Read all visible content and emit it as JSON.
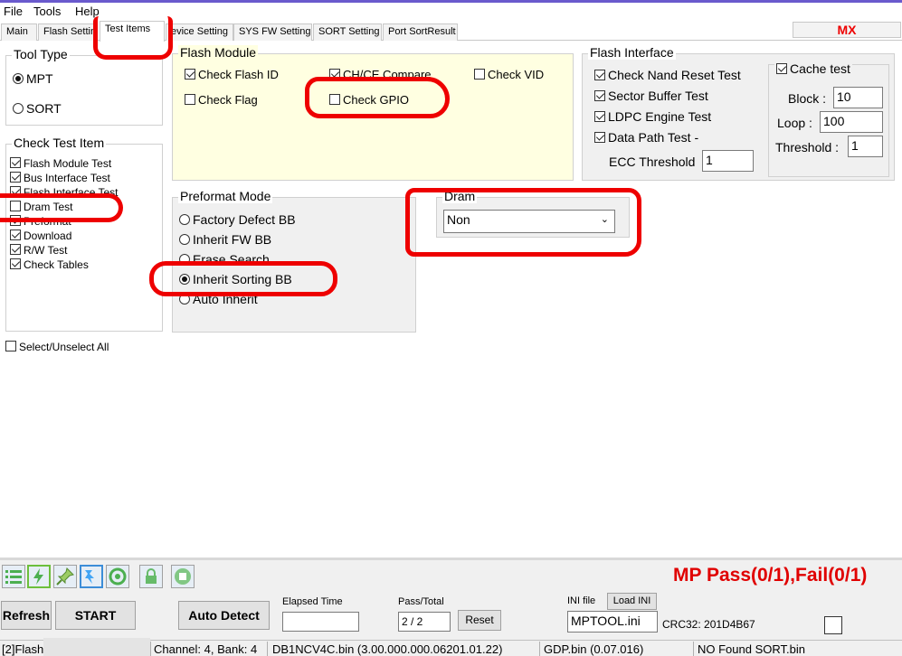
{
  "menu": {
    "file": "File",
    "tools": "Tools",
    "help": "Help"
  },
  "tabs": [
    "Main",
    "Flash Settin",
    "Test Items",
    "evice Setting",
    "SYS FW Setting",
    "SORT Setting",
    "Port SortResult"
  ],
  "mx_label": "MX",
  "tool_type": {
    "title": "Tool Type",
    "mpt": "MPT",
    "sort": "SORT",
    "selected": "MPT"
  },
  "check_test_item": {
    "title": "Check Test Item",
    "items": [
      {
        "label": "Flash Module Test",
        "checked": true
      },
      {
        "label": "Bus Interface Test",
        "checked": true
      },
      {
        "label": "Flash Interface Test",
        "checked": true
      },
      {
        "label": "Dram Test",
        "checked": false
      },
      {
        "label": "Preformat",
        "checked": true
      },
      {
        "label": "Download",
        "checked": true
      },
      {
        "label": "R/W Test",
        "checked": true
      },
      {
        "label": "Check Tables",
        "checked": true
      }
    ],
    "select_all": "Select/Unselect All"
  },
  "flash_module": {
    "title": "Flash Module",
    "check_flash_id": "Check Flash ID",
    "chce_compare": "CH/CE Compare",
    "check_vid": "Check VID",
    "check_flag": "Check Flag",
    "check_gpio": "Check GPIO"
  },
  "flash_interface": {
    "title": "Flash Interface",
    "nand_reset": "Check Nand Reset Test",
    "sector_buffer": "Sector Buffer Test",
    "ldpc_engine": "LDPC Engine Test",
    "data_path": "Data Path Test -",
    "ecc_threshold_label": "ECC Threshold",
    "ecc_threshold_value": "1",
    "cache_test": "Cache test",
    "block_label": "Block :",
    "block_value": "10",
    "loop_label": "Loop :",
    "loop_value": "100",
    "threshold_label": "Threshold :",
    "threshold_value": "1"
  },
  "preformat": {
    "title": "Preformat Mode",
    "options": [
      "Factory Defect BB",
      "Inherit FW BB",
      "Erase Search",
      "Inherit Sorting BB",
      "Auto Inherit"
    ],
    "selected": "Inherit Sorting BB"
  },
  "dram": {
    "title": "Dram",
    "value": "Non"
  },
  "bottom": {
    "mp_status": "MP  Pass(0/1),Fail(0/1)",
    "refresh": "Refresh",
    "start": "START",
    "auto_detect": "Auto Detect",
    "elapsed_label": "Elapsed Time",
    "elapsed_value": "",
    "pass_total_label": "Pass/Total",
    "pass_total_value": "2 / 2",
    "reset": "Reset",
    "ini_label": "INI file",
    "load_ini": "Load INI",
    "ini_value": "MPTOOL.ini",
    "crc": "CRC32: 201D4B67"
  },
  "statusbar": {
    "flash": "[2]Flash:",
    "channel": "Channel: 4, Bank: 4",
    "fw_bin": "DB1NCV4C.bin (3.00.000.000.06201.01.22)",
    "gdp_bin": "GDP.bin (0.07.016)",
    "sort_bin": "NO Found SORT.bin"
  },
  "colors": {
    "annotation_red": "#ee0000",
    "mp_red": "#e00000",
    "flash_module_bg": "#ffffe1"
  }
}
